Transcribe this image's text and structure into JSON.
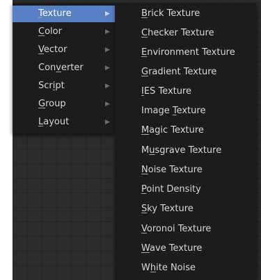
{
  "main_menu": {
    "items": [
      {
        "pre": "",
        "key": "T",
        "post": "exture",
        "active": true
      },
      {
        "pre": "",
        "key": "C",
        "post": "olor",
        "active": false
      },
      {
        "pre": "",
        "key": "V",
        "post": "ector",
        "active": false
      },
      {
        "pre": "Con",
        "key": "v",
        "post": "erter",
        "active": false
      },
      {
        "pre": "Scr",
        "key": "i",
        "post": "pt",
        "active": false
      },
      {
        "pre": "",
        "key": "G",
        "post": "roup",
        "active": false
      },
      {
        "pre": "",
        "key": "L",
        "post": "ayout",
        "active": false
      }
    ],
    "arrow_glyph": "▶"
  },
  "texture_submenu": {
    "items": [
      {
        "pre": "",
        "key": "B",
        "post": "rick Texture"
      },
      {
        "pre": "",
        "key": "C",
        "post": "hecker Texture"
      },
      {
        "pre": "",
        "key": "E",
        "post": "nvironment Texture"
      },
      {
        "pre": "",
        "key": "G",
        "post": "radient Texture"
      },
      {
        "pre": "",
        "key": "I",
        "post": "ES Texture"
      },
      {
        "pre": "Image ",
        "key": "T",
        "post": "exture"
      },
      {
        "pre": "",
        "key": "M",
        "post": "agic Texture"
      },
      {
        "pre": "M",
        "key": "u",
        "post": "sgrave Texture"
      },
      {
        "pre": "",
        "key": "N",
        "post": "oise Texture"
      },
      {
        "pre": "",
        "key": "P",
        "post": "oint Density"
      },
      {
        "pre": "",
        "key": "S",
        "post": "ky Texture"
      },
      {
        "pre": "",
        "key": "V",
        "post": "oronoi Texture"
      },
      {
        "pre": "",
        "key": "W",
        "post": "ave Texture"
      },
      {
        "pre": "W",
        "key": "h",
        "post": "ite Noise"
      }
    ]
  },
  "colors": {
    "menu_bg": "#1c1c1c",
    "highlight": "#5680c2",
    "text": "#d8d8d8",
    "grid_bg": "#2b2b2b"
  }
}
